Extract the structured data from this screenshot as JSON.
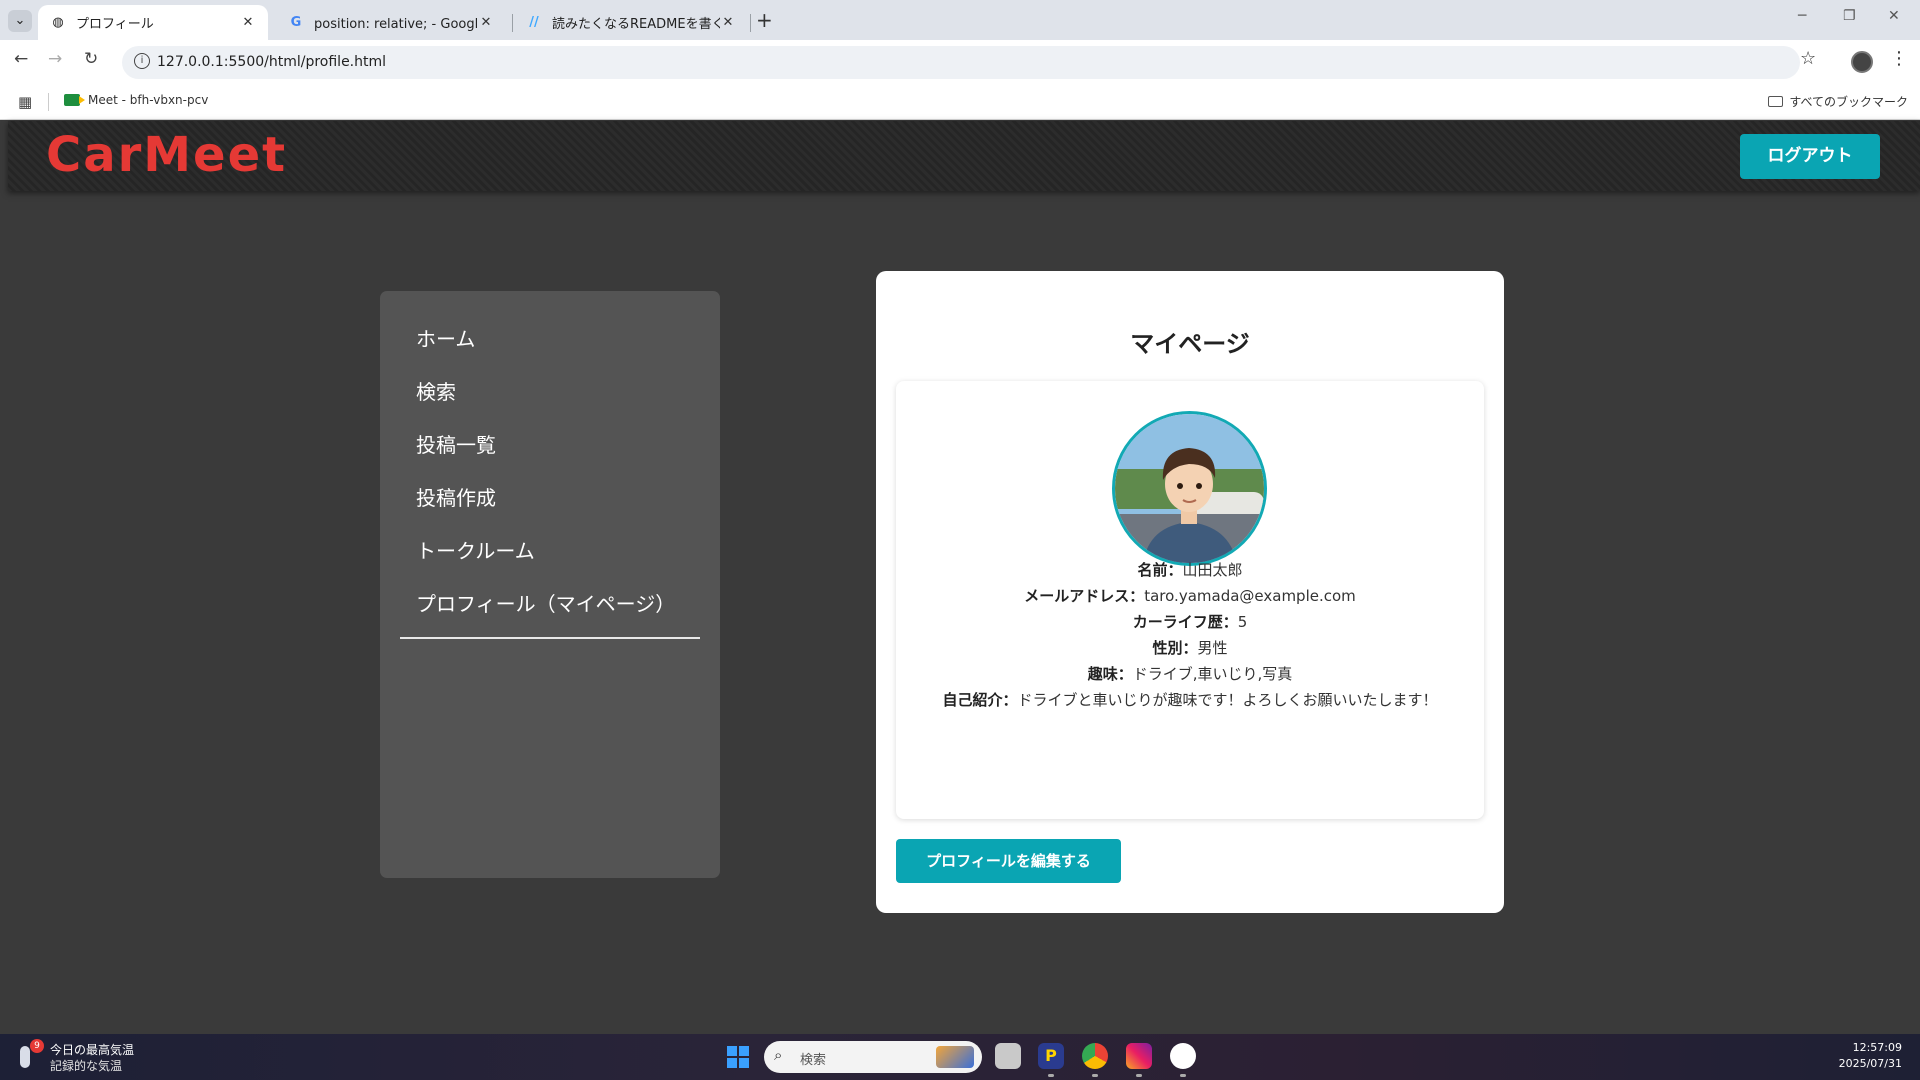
{
  "browser": {
    "tabs": [
      {
        "title": "プロフィール",
        "active": true
      },
      {
        "title": "position: relative; - Google 検索",
        "active": false
      },
      {
        "title": "読みたくなるREADMEを書くための",
        "active": false
      }
    ],
    "url": "127.0.0.1:5500/html/profile.html",
    "bookmarks": [
      {
        "label": "Meet - bfh-vbxn-pcv"
      }
    ],
    "all_bookmarks_label": "すべてのブックマーク"
  },
  "site": {
    "logo": "CarMeet",
    "logout_label": "ログアウト"
  },
  "sidebar": {
    "items": [
      {
        "label": "ホーム"
      },
      {
        "label": "検索"
      },
      {
        "label": "投稿一覧"
      },
      {
        "label": "投稿作成"
      },
      {
        "label": "トークルーム"
      },
      {
        "label": "プロフィール（マイページ）"
      }
    ]
  },
  "profile": {
    "title": "マイページ",
    "fields": [
      {
        "label": "名前：",
        "value": "山田太郎"
      },
      {
        "label": "メールアドレス：",
        "value": "taro.yamada@example.com"
      },
      {
        "label": "カーライフ歴：",
        "value": "5"
      },
      {
        "label": "性別：",
        "value": "男性"
      },
      {
        "label": "趣味：",
        "value": "ドライブ,車いじり,写真"
      },
      {
        "label": "自己紹介：",
        "value": "ドライブと車いじりが趣味です！よろしくお願いいたします！"
      }
    ],
    "edit_label": "プロフィールを編集する"
  },
  "taskbar": {
    "weather_badge": "9",
    "weather_title": "今日の最高気温",
    "weather_sub": "記録的な気温",
    "search_placeholder": "検索",
    "time": "12:57:09",
    "date": "2025/07/31"
  },
  "colors": {
    "accent": "#0aa5b3",
    "logo": "#e53935",
    "page_bg": "#3a3a3a",
    "sidebar_bg": "#545454"
  }
}
